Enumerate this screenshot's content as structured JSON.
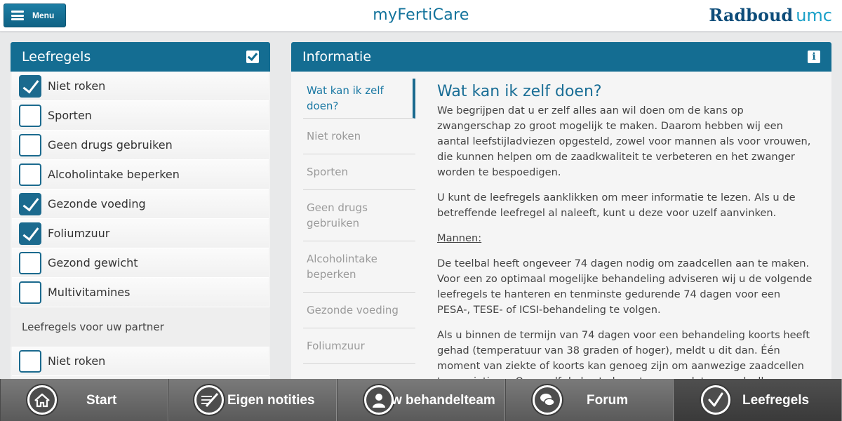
{
  "header": {
    "menu_label": "Menu",
    "app_title": "myFertiCare",
    "logo_part1": "Radboud",
    "logo_part2": "umc"
  },
  "leefregels": {
    "title": "Leefregels",
    "items": [
      {
        "label": "Niet roken",
        "checked": true
      },
      {
        "label": "Sporten",
        "checked": false
      },
      {
        "label": "Geen drugs gebruiken",
        "checked": false
      },
      {
        "label": "Alcoholintake beperken",
        "checked": false
      },
      {
        "label": "Gezonde voeding",
        "checked": true
      },
      {
        "label": "Foliumzuur",
        "checked": true
      },
      {
        "label": "Gezond gewicht",
        "checked": false
      },
      {
        "label": "Multivitamines",
        "checked": false
      }
    ],
    "partner_section_label": "Leefregels voor uw partner",
    "partner_items": [
      {
        "label": "Niet roken",
        "checked": false
      }
    ]
  },
  "informatie": {
    "title": "Informatie",
    "nav": [
      {
        "label": "Wat kan ik zelf doen?",
        "active": true
      },
      {
        "label": "Niet roken",
        "active": false
      },
      {
        "label": "Sporten",
        "active": false
      },
      {
        "label": "Geen drugs gebruiken",
        "active": false
      },
      {
        "label": "Alcoholintake beperken",
        "active": false
      },
      {
        "label": "Gezonde voeding",
        "active": false
      },
      {
        "label": "Foliumzuur",
        "active": false
      }
    ],
    "content": {
      "heading": "Wat kan ik zelf doen?",
      "p1": "We begrijpen dat u er zelf alles aan wil doen om de kans op zwangerschap zo groot mogelijk te maken. Daarom hebben wij een aantal leefstijladviezen opgesteld, zowel voor mannen als voor vrouwen, die kunnen helpen om de zaadkwaliteit te verbeteren en het zwanger worden te bespoedigen.",
      "p2": "U kunt de leefregels aanklikken om meer informatie te lezen. Als u de betreffende leefregel al naleeft, kunt u deze voor uzelf aanvinken.",
      "p3": "Mannen:",
      "p4": "De teelbal heeft ongeveer 74 dagen nodig om zaadcellen aan te maken. Voor een zo optimaal mogelijke behandeling adviseren wij u de volgende leefregels te hanteren en tenminste gedurende 74 dagen voor een PESA-, TESE- of ICSI-behandeling te volgen.",
      "p5": "Als u binnen de termijn van 74 dagen voor een behandeling koorts heeft gehad (temperatuur van 38 graden of hoger), meldt u dit dan. Één moment van ziekte of koorts kan genoeg zijn om aanwezige zaadcellen te vernietigen. Om uzelf de beste kans te geven dat er zaadcellen gevonden"
    }
  },
  "bottom_nav": [
    {
      "label": "Start",
      "icon": "home-icon",
      "active": false
    },
    {
      "label": "Eigen notities",
      "icon": "notes-icon",
      "active": false
    },
    {
      "label": "w behandelteam",
      "icon": "team-icon",
      "active": false
    },
    {
      "label": "Forum",
      "icon": "forum-icon",
      "active": false
    },
    {
      "label": "Leefregels",
      "icon": "check-icon",
      "active": true
    }
  ],
  "colors": {
    "primary": "#146d92",
    "accent": "#1aa0c8",
    "nav_bg": "#6a6a6a"
  }
}
